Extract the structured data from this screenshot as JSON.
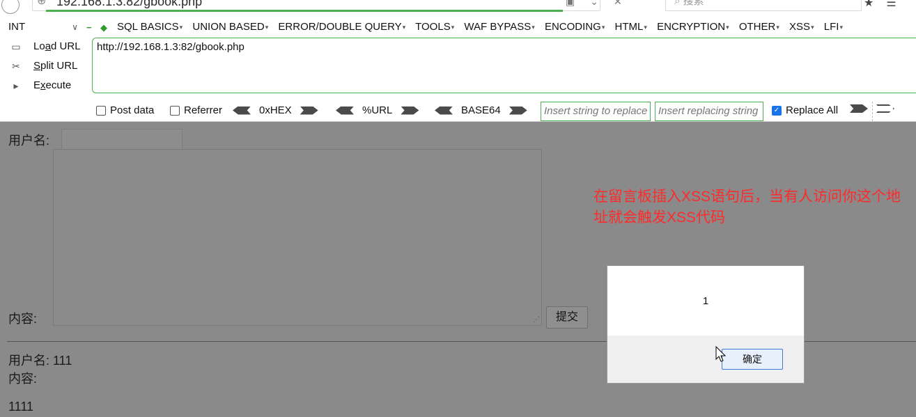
{
  "browser": {
    "url_partial": "192.168.1.3:82/gbook.php",
    "search_placeholder": "搜索"
  },
  "hackbar": {
    "select_value": "INT",
    "menu": [
      "SQL BASICS",
      "UNION BASED",
      "ERROR/DOUBLE QUERY",
      "TOOLS",
      "WAF BYPASS",
      "ENCODING",
      "HTML",
      "ENCRYPTION",
      "OTHER",
      "XSS",
      "LFI"
    ],
    "actions": {
      "load": {
        "pre": "Lo",
        "ul": "a",
        "post": "d URL"
      },
      "split": {
        "pre": "",
        "ul": "S",
        "post": "plit URL"
      },
      "execute": {
        "pre": "E",
        "ul": "x",
        "post": "ecute"
      }
    },
    "url_value": "http://192.168.1.3:82/gbook.php",
    "post_data_label": "Post data",
    "referrer_label": "Referrer",
    "hex_label": "0xHEX",
    "url_enc_label": "%URL",
    "base64_label": "BASE64",
    "insert_string_placeholder": "Insert string to replace",
    "insert_replacing_placeholder": "Insert replacing string",
    "replace_all_label": "Replace All",
    "replace_all_checked": true,
    "post_data_checked": false,
    "referrer_checked": false
  },
  "page": {
    "username_label": "用户名:",
    "content_label": "内容:",
    "submit_label": "提交",
    "entry_username": "用户名: 111",
    "entry_content_label": "内容:",
    "entry_content": "1111",
    "annotation_line1": "在留言板插入XSS语句后，当有人访问你这个地",
    "annotation_line2": "址就会触发XSS代码"
  },
  "alert": {
    "message": "1",
    "ok_label": "确定"
  },
  "colors": {
    "accent_green": "#4caf50",
    "annotation_red": "#ff2a2a",
    "overlay_gray": "#8a8a8a"
  }
}
